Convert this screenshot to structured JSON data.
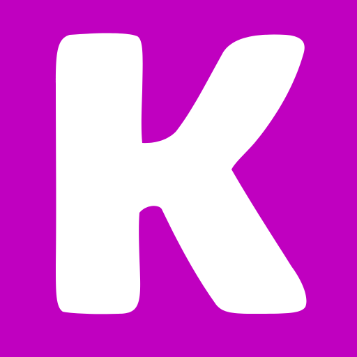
{
  "logo": {
    "letter": "K",
    "background_color": "#C000C0",
    "glyph_color": "#FFFFFF"
  }
}
